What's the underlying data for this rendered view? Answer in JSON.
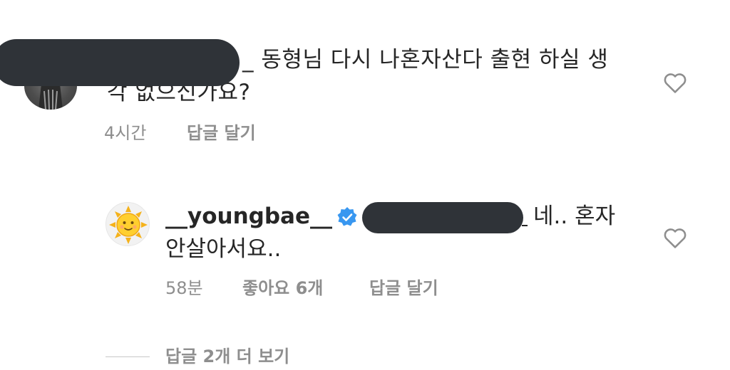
{
  "comment_1": {
    "text_line1": "_ 동형님 다시 나혼자산다 출현 하실 생",
    "text_line2_visible": "각 없으신가요?",
    "time": "4시간",
    "reply_label": "답글 달기",
    "like_icon": "heart-outline-icon"
  },
  "reply": {
    "username": "__youngbae__",
    "verified_icon": "verified-badge-icon",
    "text_line1": "네.. 혼자",
    "text_line2": "안살아서요..",
    "time": "58분",
    "likes_label": "좋아요 6개",
    "reply_label": "답글 달기",
    "like_icon": "heart-outline-icon",
    "avatar_icon": "sun-emoji-avatar"
  },
  "view_more": {
    "label": "답글 2개 더 보기"
  },
  "colors": {
    "text": "#262626",
    "secondary": "#8e8e8e",
    "verified": "#3897f0",
    "redaction": "#2f3338"
  }
}
